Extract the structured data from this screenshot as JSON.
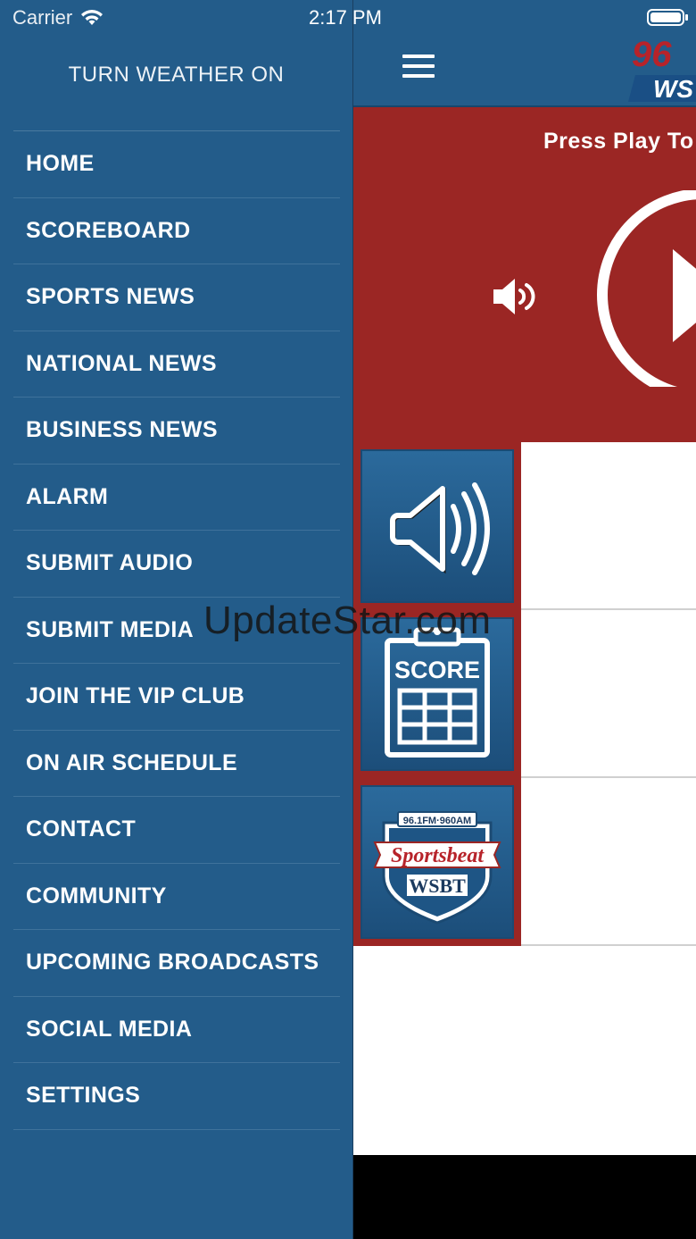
{
  "status_bar": {
    "carrier": "Carrier",
    "time": "2:17 PM"
  },
  "drawer": {
    "weather_toggle": "TURN WEATHER ON",
    "menu": [
      {
        "label": "HOME"
      },
      {
        "label": "SCOREBOARD"
      },
      {
        "label": "SPORTS NEWS"
      },
      {
        "label": "NATIONAL NEWS"
      },
      {
        "label": "BUSINESS NEWS"
      },
      {
        "label": "ALARM"
      },
      {
        "label": "SUBMIT AUDIO"
      },
      {
        "label": "SUBMIT MEDIA"
      },
      {
        "label": "JOIN THE VIP CLUB"
      },
      {
        "label": "ON AIR SCHEDULE"
      },
      {
        "label": "CONTACT"
      },
      {
        "label": "COMMUNITY"
      },
      {
        "label": "UPCOMING BROADCASTS"
      },
      {
        "label": "SOCIAL MEDIA"
      },
      {
        "label": "SETTINGS"
      }
    ]
  },
  "main": {
    "logo_text": {
      "top": "96",
      "bottom": "WS"
    },
    "player": {
      "prompt": "Press Play To I"
    },
    "tiles": [
      {
        "icon": "speaker-icon"
      },
      {
        "icon": "scoreboard-icon",
        "label": "SCORE"
      },
      {
        "icon": "sportsbeat-logo-icon",
        "logo_top": "96.1FM·960AM",
        "logo_mid": "Sportsbeat",
        "logo_bottom": "WSBT"
      }
    ]
  },
  "watermark": "UpdateStar.com",
  "colors": {
    "drawer_blue": "#235c8a",
    "brand_red": "#9b2624"
  }
}
